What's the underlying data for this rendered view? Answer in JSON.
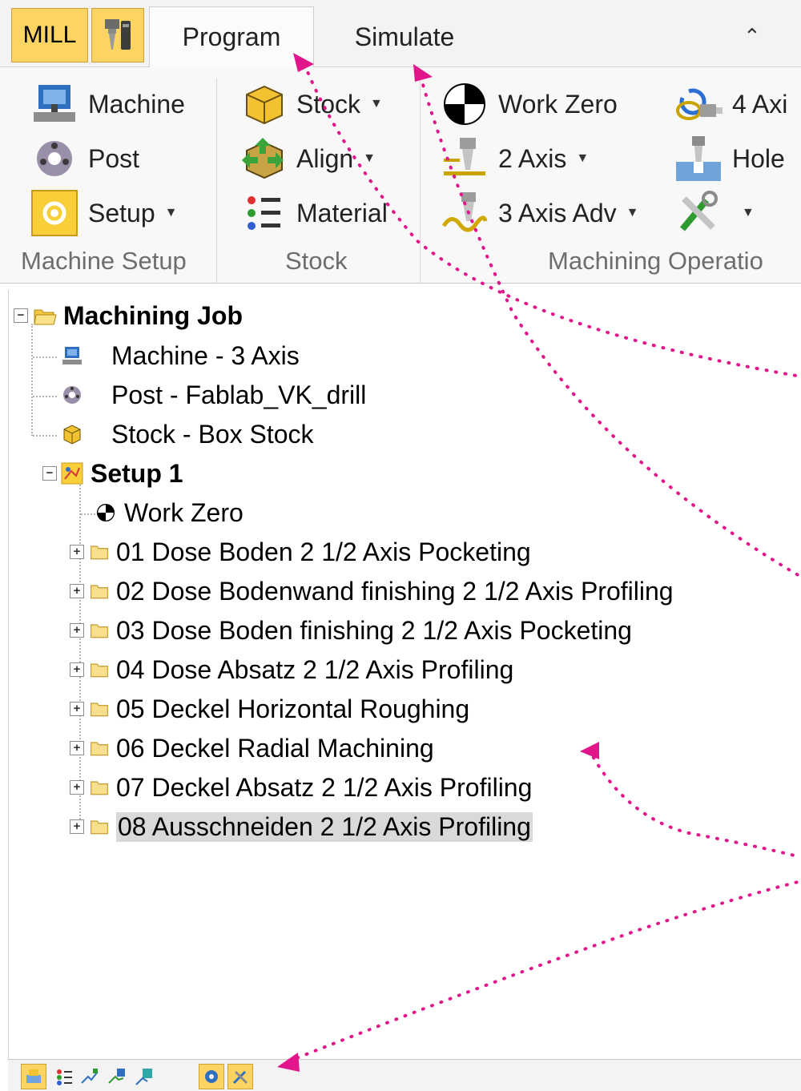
{
  "tabbar": {
    "mode_label": "MILL",
    "tabs": [
      {
        "label": "Program",
        "active": true
      },
      {
        "label": "Simulate",
        "active": false
      }
    ]
  },
  "ribbon": {
    "groups": [
      {
        "label": "Machine Setup",
        "buttons": [
          "Machine",
          "Post",
          "Setup"
        ]
      },
      {
        "label": "Stock",
        "buttons": [
          "Stock",
          "Align",
          "Material"
        ]
      },
      {
        "label": "Machining Operatio",
        "buttons": [
          "Work Zero",
          "2 Axis",
          "3 Axis Adv",
          "4 Axi",
          "Hole"
        ]
      }
    ]
  },
  "tree": {
    "root": "Machining Job",
    "machine": "Machine - 3 Axis",
    "post": "Post - Fablab_VK_drill",
    "stock": "Stock - Box Stock",
    "setup": "Setup 1",
    "work_zero": "Work Zero",
    "operations": [
      "01 Dose Boden 2 1/2 Axis Pocketing",
      "02 Dose Bodenwand finishing 2 1/2 Axis Profiling",
      "03 Dose Boden finishing 2 1/2 Axis Pocketing",
      "04 Dose Absatz 2 1/2 Axis Profiling",
      "05 Deckel Horizontal Roughing",
      "06 Deckel Radial Machining",
      "07 Deckel Absatz 2 1/2 Axis Profiling",
      "08 Ausschneiden 2 1/2 Axis Profiling"
    ],
    "selected_index": 7
  },
  "colors": {
    "accent": "#fbd462",
    "annotation": "#e0168a",
    "selection": "#d9d9d9"
  }
}
